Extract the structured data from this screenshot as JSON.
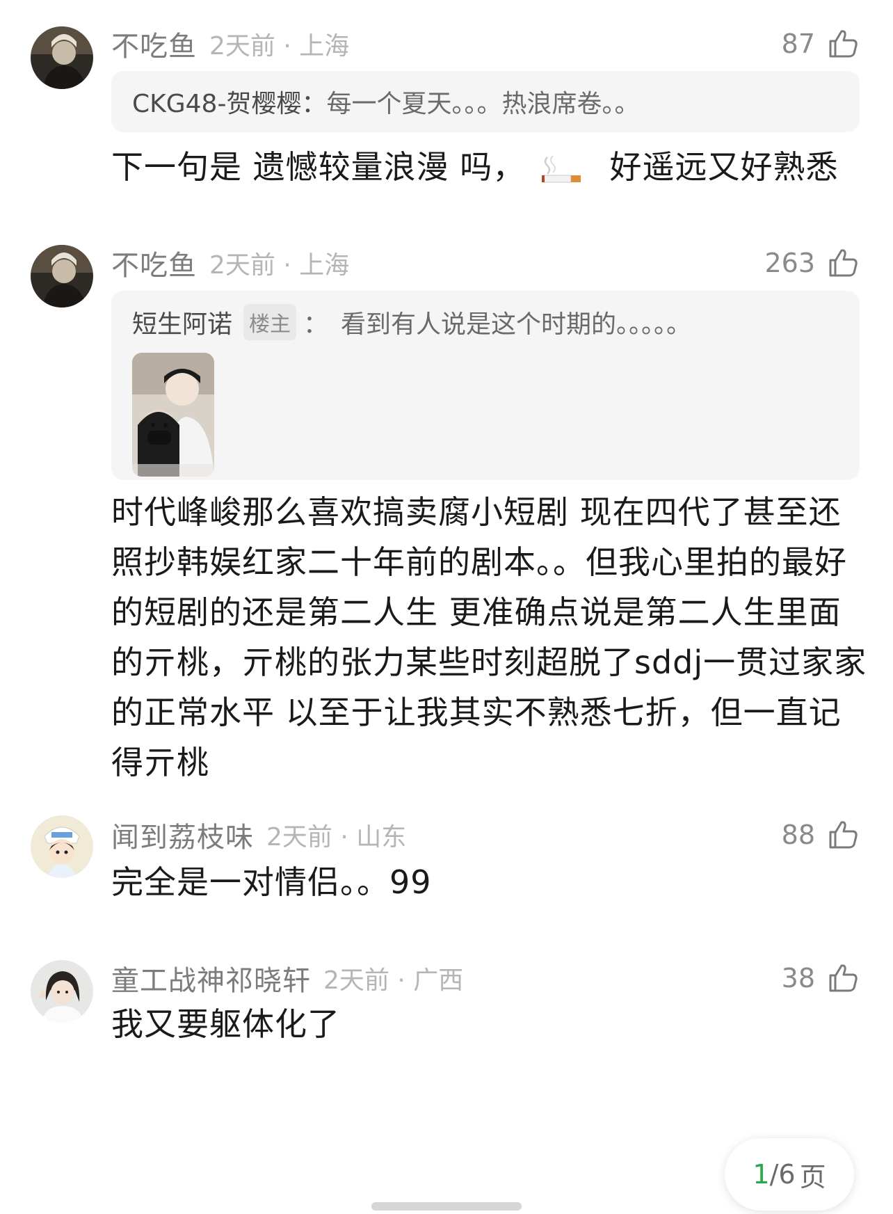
{
  "comments": [
    {
      "username": "不吃鱼",
      "time": "2天前",
      "location": "上海",
      "likes": "87",
      "quote": {
        "user": "CKG48-贺樱樱：",
        "text": "每一个夏天。。。热浪席卷。。"
      },
      "body_before_emoji": "下一句是 遗憾较量浪漫 吗，",
      "emoji_icon": "cigarette-emoji",
      "body_after_emoji": "好遥远又好熟悉"
    },
    {
      "username": "不吃鱼",
      "time": "2天前",
      "location": "上海",
      "likes": "263",
      "quote": {
        "user": "短生阿诺",
        "badge": "楼主",
        "separator": "：",
        "text": "看到有人说是这个时期的。。。。。"
      },
      "body": "时代峰峻那么喜欢搞卖腐小短剧 现在四代了甚至还照抄韩娱红家二十年前的剧本。。但我心里拍的最好的短剧的还是第二人生 更准确点说是第二人生里面的亓桃，亓桃的张力某些时刻超脱了sddj一贯过家家的正常水平 以至于让我其实不熟悉七折，但一直记得亓桃"
    },
    {
      "username": "闻到荔枝味",
      "time": "2天前",
      "location": "山东",
      "likes": "88",
      "body": "完全是一对情侣。。99"
    },
    {
      "username": "童工战神祁晓轩",
      "time": "2天前",
      "location": "广西",
      "likes": "38",
      "body": "我又要躯体化了"
    }
  ],
  "meta_separator": "·",
  "pager": {
    "current": "1",
    "total": "/6",
    "suffix": "页"
  },
  "colors": {
    "accent": "#2aa94a",
    "quote_bg": "#f5f5f5",
    "meta": "#b5b5b5"
  }
}
